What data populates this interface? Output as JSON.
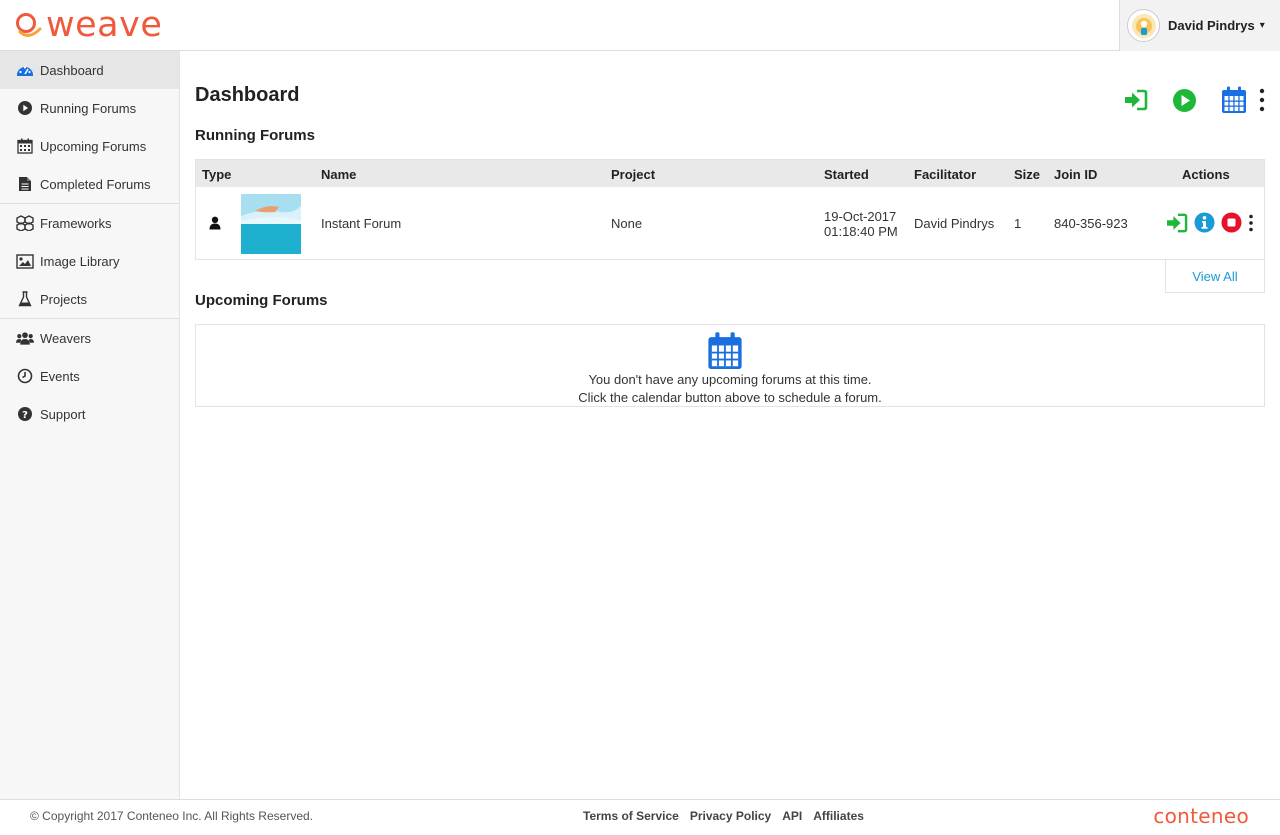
{
  "app": {
    "logo_text": "weave",
    "brand_color": "#f05a3c"
  },
  "user": {
    "name": "David Pindrys",
    "caret": "▾"
  },
  "sidebar": {
    "items": [
      {
        "label": "Dashboard",
        "icon": "dashboard-icon",
        "active": true
      },
      {
        "label": "Running Forums",
        "icon": "play-circle-icon"
      },
      {
        "label": "Upcoming Forums",
        "icon": "calendar-icon"
      },
      {
        "label": "Completed Forums",
        "icon": "document-icon"
      },
      {
        "label": "Frameworks",
        "icon": "cubes-icon"
      },
      {
        "label": "Image Library",
        "icon": "image-icon"
      },
      {
        "label": "Projects",
        "icon": "flask-icon"
      },
      {
        "label": "Weavers",
        "icon": "users-icon"
      },
      {
        "label": "Events",
        "icon": "clock-icon"
      },
      {
        "label": "Support",
        "icon": "question-circle-icon"
      }
    ]
  },
  "main": {
    "title": "Dashboard",
    "top_actions": [
      "join-forum-icon",
      "start-forum-icon",
      "schedule-calendar-icon",
      "more-vertical-icon"
    ],
    "running": {
      "title": "Running Forums",
      "columns": [
        "Type",
        "Name",
        "Project",
        "Started",
        "Facilitator",
        "Size",
        "Join ID",
        "Actions"
      ],
      "rows": [
        {
          "type_icon": "user-icon",
          "name": "Instant Forum",
          "project": "None",
          "started_date": "19-Oct-2017",
          "started_time": "01:18:40 PM",
          "facilitator": "David Pindrys",
          "size": "1",
          "join_id": "840-356-923",
          "actions": [
            "join-icon",
            "info-icon",
            "stop-icon",
            "more-vertical-icon"
          ]
        }
      ],
      "view_all": "View All"
    },
    "upcoming": {
      "title": "Upcoming Forums",
      "empty_line1": "You don't have any upcoming forums at this time.",
      "empty_line2": "Click the calendar button above to schedule a forum."
    }
  },
  "footer": {
    "copyright": "© Copyright 2017 Conteneo Inc. All Rights Reserved.",
    "links": [
      "Terms of Service",
      "Privacy Policy",
      "API",
      "Affiliates"
    ],
    "brand": "conteneo"
  },
  "colors": {
    "green": "#1db83a",
    "blue": "#1a6fe0",
    "info": "#1a9ad6",
    "red": "#e8102a"
  }
}
